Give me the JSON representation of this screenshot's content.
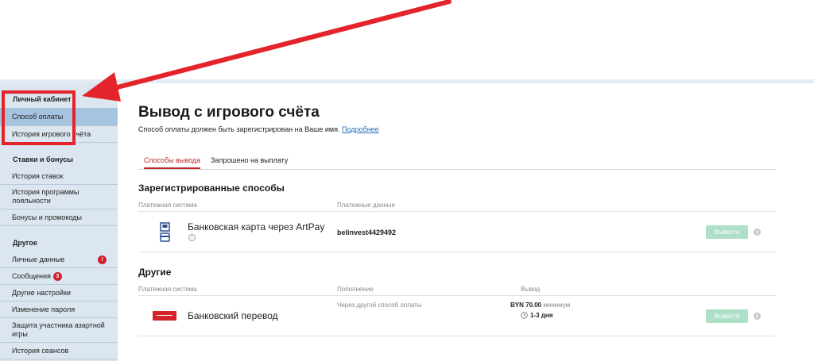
{
  "sidebar": {
    "groups": [
      {
        "heading": "Личный кабинет",
        "items": [
          {
            "label": "Способ оплаты",
            "active": true
          },
          {
            "label": "История игрового счёта"
          }
        ]
      },
      {
        "heading": "Ставки и бонусы",
        "items": [
          {
            "label": "История ставок"
          },
          {
            "label": "История программы лояльности"
          },
          {
            "label": "Бонусы и промокоды"
          }
        ]
      },
      {
        "heading": "Другое",
        "items": [
          {
            "label": "Личные данные",
            "badge": "!"
          },
          {
            "label": "Сообщения",
            "badge": "3"
          },
          {
            "label": "Другие настройки"
          },
          {
            "label": "Изменение пароля"
          },
          {
            "label": "Защита участника азартной игры"
          },
          {
            "label": "История сеансов"
          }
        ]
      }
    ]
  },
  "main": {
    "title": "Вывод с игрового счёта",
    "subtitle": "Способ оплаты должен быть зарегистрирован на Ваше имя.",
    "subtitle_link": "Подробнее",
    "tabs": [
      {
        "label": "Способы вывода",
        "active": true
      },
      {
        "label": "Запрошено на выплату"
      }
    ],
    "registered": {
      "title": "Зарегистрированные способы",
      "col_system": "Платежная система",
      "col_data": "Платежные данные",
      "row": {
        "name": "Банковская карта через ArtPay",
        "data": "belinvest4429492",
        "button": "Вывести"
      }
    },
    "other": {
      "title": "Другие",
      "col_system": "Платежная система",
      "col_deposit": "Пополнение",
      "col_withdraw": "Вывод",
      "row": {
        "name": "Банковский перевод",
        "deposit": "Через другой способ оплаты",
        "amount": "BYN 70.00",
        "amount_note": "минимум",
        "duration": "1-3 дня",
        "button": "Вывести"
      }
    }
  },
  "colors": {
    "accent": "#c0282d",
    "sidebar_bg": "#dce6f0",
    "sidebar_active": "#a6c3e0",
    "button_disabled": "#aee0c8",
    "annotation": "#e3242b"
  }
}
